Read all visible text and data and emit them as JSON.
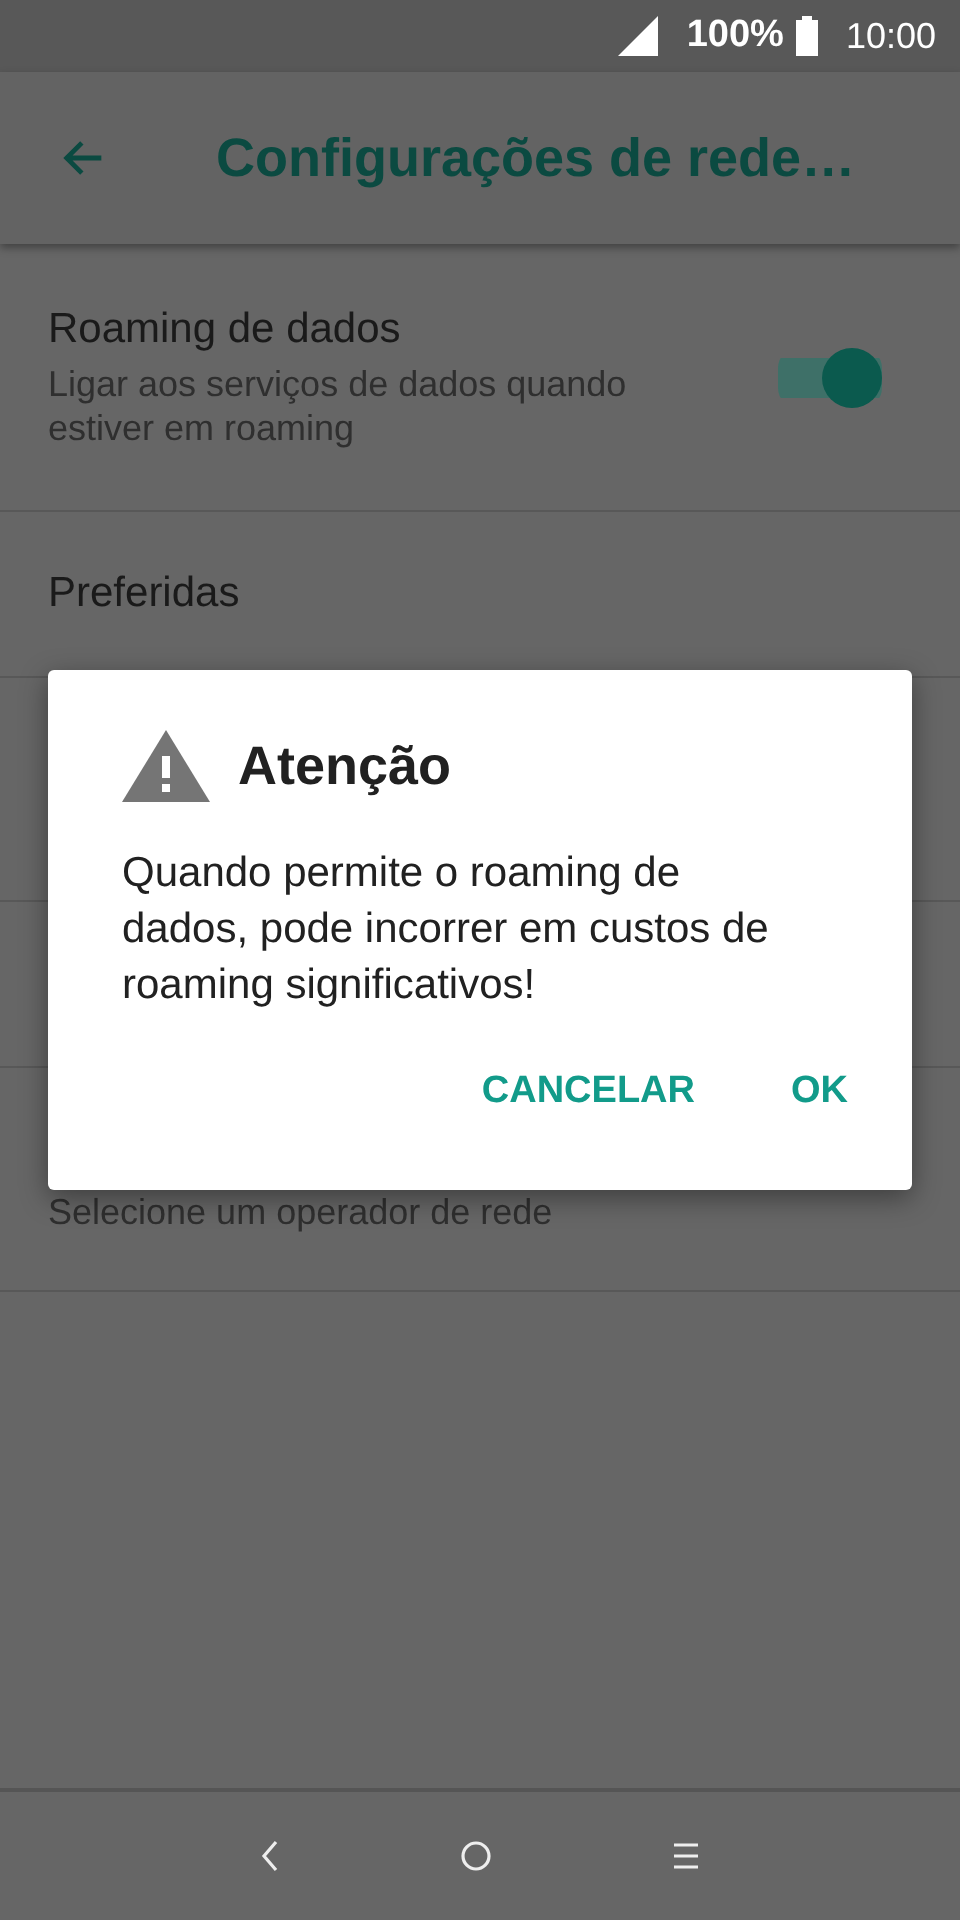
{
  "status_bar": {
    "battery": "100%",
    "time": "10:00"
  },
  "toolbar": {
    "title": "Configurações de rede…"
  },
  "settings": [
    {
      "kind": "switch",
      "title": "Roaming de dados",
      "subtitle": "Ligar aos serviços de dados quando estiver em roaming",
      "on": true
    },
    {
      "kind": "plain",
      "title": "Preferidas"
    },
    {
      "kind": "subtitle_only",
      "subtitle": "Selecione um operador de rede"
    }
  ],
  "dialog": {
    "title": "Atenção",
    "message": "Quando permite o roaming de dados, pode incorrer em custos de roaming significativos!",
    "buttons": [
      "CANCELAR",
      "OK"
    ]
  }
}
